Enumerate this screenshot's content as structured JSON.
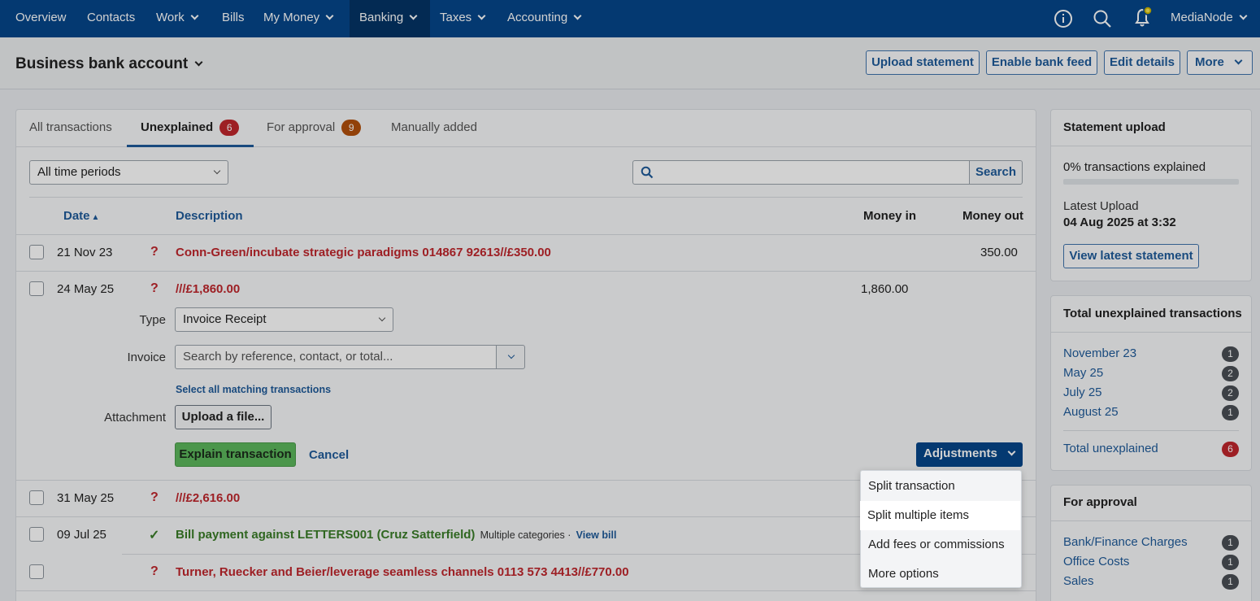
{
  "nav": {
    "items": [
      {
        "label": "Overview"
      },
      {
        "label": "Contacts"
      },
      {
        "label": "Work"
      },
      {
        "label": "Bills"
      },
      {
        "label": "My Money"
      },
      {
        "label": "Banking"
      },
      {
        "label": "Taxes"
      },
      {
        "label": "Accounting"
      }
    ],
    "account": "MediaNode",
    "icons": [
      "info-icon",
      "search-icon",
      "bell-icon"
    ]
  },
  "page": {
    "title": "Business bank account",
    "buttons": [
      "Upload statement",
      "Enable bank feed",
      "Edit details",
      "More"
    ]
  },
  "tabs": [
    {
      "label": "All transactions"
    },
    {
      "label": "Unexplained",
      "count": "6"
    },
    {
      "label": "For approval",
      "count": "9"
    },
    {
      "label": "Manually added"
    }
  ],
  "filters": {
    "period": "All time periods",
    "search_placeholder": "",
    "search_button": "Search"
  },
  "table": {
    "headers": {
      "date": "Date",
      "description": "Description",
      "money_in": "Money in",
      "money_out": "Money out"
    },
    "rows": [
      {
        "date": "21 Nov 23",
        "status": "?",
        "description": "Conn-Green/incubate strategic paradigms 014867 92613//£350.00",
        "money_in": "",
        "money_out": "350.00"
      },
      {
        "date": "24 May 25",
        "status": "?",
        "description": "///£1,860.00",
        "money_in": "1,860.00",
        "money_out": ""
      },
      {
        "date": "31 May 25",
        "status": "?",
        "description": "///£2,616.00",
        "money_in": "",
        "money_out": ""
      },
      {
        "date": "09 Jul 25",
        "status": "✓",
        "description": "Bill payment against LETTERS001 (Cruz Satterfield)",
        "extra": "Multiple categories ·",
        "link": "View bill"
      },
      {
        "date": "",
        "status": "?",
        "description": "Turner, Ruecker and Beier/leverage seamless channels 0113 573 4413//£770.00"
      }
    ]
  },
  "explain": {
    "type_label": "Type",
    "type_value": "Invoice Receipt",
    "invoice_label": "Invoice",
    "invoice_placeholder": "Search by reference, contact, or total...",
    "select_all": "Select all matching transactions",
    "attachment_label": "Attachment",
    "upload_button": "Upload a file...",
    "explain_button": "Explain transaction",
    "cancel": "Cancel",
    "adjustments": "Adjustments"
  },
  "adjustments_menu": [
    "Split transaction",
    "Split multiple items",
    "Add fees or commissions",
    "More options"
  ],
  "statement": {
    "title": "Statement upload",
    "progress_text": "0% transactions explained",
    "progress": 0,
    "latest_label": "Latest Upload",
    "latest_value": "04 Aug 2025 at 3:32",
    "view_button": "View latest statement"
  },
  "unexplained": {
    "title": "Total unexplained transactions",
    "items": [
      {
        "label": "November 23",
        "count": "1"
      },
      {
        "label": "May 25",
        "count": "2"
      },
      {
        "label": "July 25",
        "count": "2"
      },
      {
        "label": "August 25",
        "count": "1"
      }
    ],
    "total_label": "Total unexplained",
    "total_count": "6"
  },
  "approval": {
    "title": "For approval",
    "items": [
      {
        "label": "Bank/Finance Charges",
        "count": "1"
      },
      {
        "label": "Office Costs",
        "count": "1"
      },
      {
        "label": "Sales",
        "count": "1"
      }
    ]
  },
  "colors": {
    "nav": "#06468a",
    "accent": "#1f5b9a",
    "danger": "#c0272d",
    "success": "#3a7d28",
    "explain_button": "#5cb85c",
    "adjustments": "#06468a"
  }
}
